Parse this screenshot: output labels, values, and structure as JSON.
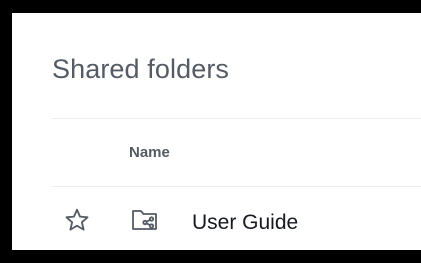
{
  "panel": {
    "title": "Shared folders"
  },
  "table": {
    "columns": [
      "Name"
    ],
    "rows": [
      {
        "name": "User Guide",
        "starred": false,
        "icon": "shared-folder-icon"
      }
    ]
  },
  "icons": {
    "favorite": "star-outline-icon",
    "folder": "shared-folder-icon"
  },
  "colors": {
    "title": "#545b64",
    "text": "#16191f",
    "divider": "#eaeded",
    "background": "#ffffff",
    "outer_border": "#000000"
  }
}
